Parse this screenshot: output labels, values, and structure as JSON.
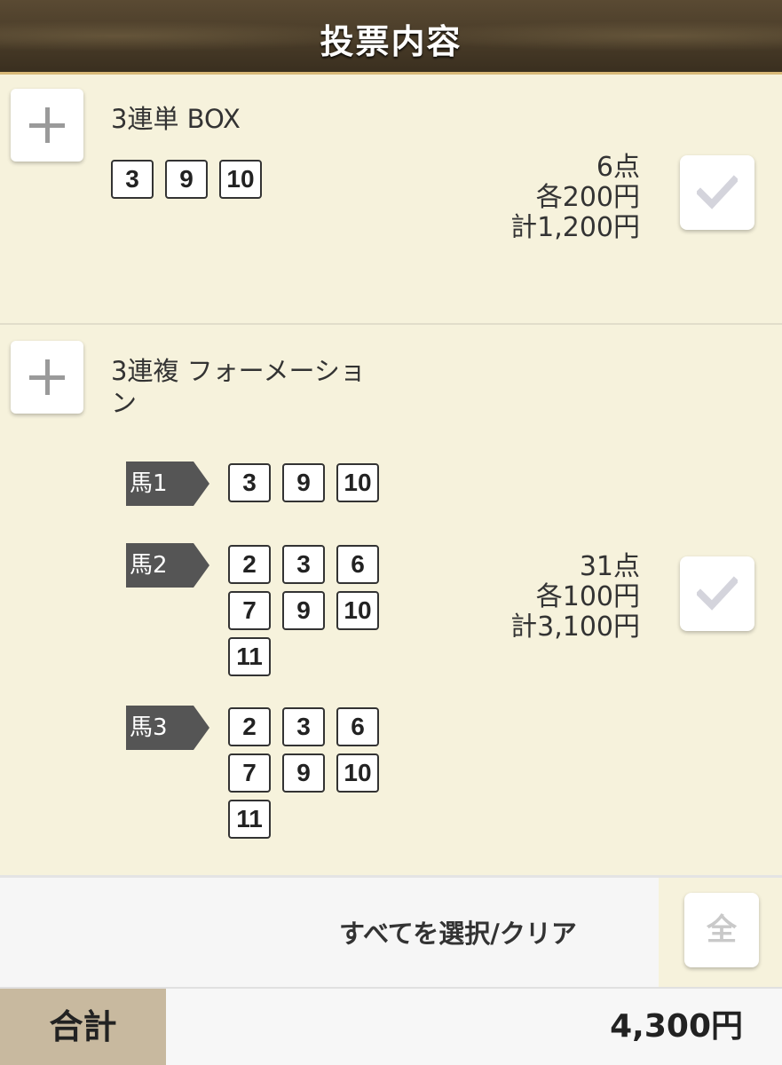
{
  "header": {
    "title": "投票内容"
  },
  "bets": [
    {
      "type": "3連単 BOX",
      "numbers": [
        "3",
        "9",
        "10"
      ],
      "points": "6点",
      "each": "各200円",
      "total": "計1,200円"
    },
    {
      "type_line1": "3連複 フォーメーショ",
      "type_line2": "ン",
      "legs": [
        {
          "label": "馬1",
          "numbers": [
            "3",
            "9",
            "10"
          ]
        },
        {
          "label": "馬2",
          "numbers": [
            "2",
            "3",
            "6",
            "7",
            "9",
            "10",
            "11"
          ]
        },
        {
          "label": "馬3",
          "numbers": [
            "2",
            "3",
            "6",
            "7",
            "9",
            "10",
            "11"
          ]
        }
      ],
      "points": "31点",
      "each": "各100円",
      "total": "計3,100円"
    }
  ],
  "select_all": {
    "label": "すべてを選択/クリア",
    "button": "全"
  },
  "total": {
    "label": "合計",
    "value": "4,300円"
  },
  "icons": {
    "add": "plus-icon",
    "check": "checkmark-icon"
  },
  "colors": {
    "background": "#f6f2dc",
    "header": "#4a3c28",
    "leg_label": "#555555",
    "total_label_bg": "#c8b99f"
  }
}
